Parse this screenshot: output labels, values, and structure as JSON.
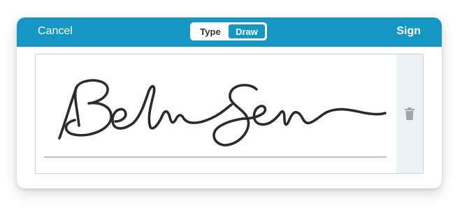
{
  "header": {
    "cancel_label": "Cancel",
    "sign_label": "Sign",
    "mode_options": [
      "Type",
      "Draw"
    ],
    "selected_mode": "Draw"
  },
  "colors": {
    "header_bg": "#1597c4",
    "accent": "#1597c4",
    "ink": "#2b2b2b",
    "side_strip": "#eef1f4"
  },
  "icons": {
    "delete": "trash-icon"
  }
}
